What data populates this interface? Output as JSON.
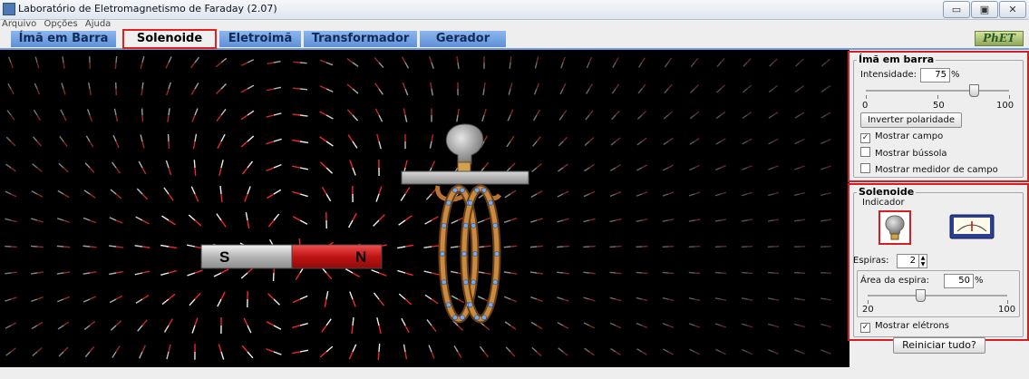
{
  "window": {
    "title": "Laboratório de Eletromagnetismo de Faraday (2.07)",
    "minimize_glyph": "▭",
    "maximize_glyph": "▣",
    "close_glyph": "✕"
  },
  "menu": [
    "Arquivo",
    "Opções",
    "Ajuda"
  ],
  "tabs": [
    {
      "label": "Ímã em Barra",
      "selected": false
    },
    {
      "label": "Solenoide",
      "selected": true
    },
    {
      "label": "Eletroimã",
      "selected": false
    },
    {
      "label": "Transformador",
      "selected": false
    },
    {
      "label": "Gerador",
      "selected": false
    }
  ],
  "logo_text": "PhET",
  "magnet": {
    "south": "S",
    "north": "N"
  },
  "bar_magnet_panel": {
    "title": "Ímã em barra",
    "strength_label": "Intensidade:",
    "strength_value": "75",
    "strength_unit": "%",
    "strength_fraction": 0.75,
    "scale": [
      "0",
      "50",
      "100"
    ],
    "flip_button": "Inverter polaridade",
    "checkboxes": [
      {
        "label": "Mostrar campo",
        "checked": true
      },
      {
        "label": "Mostrar bússola",
        "checked": false
      },
      {
        "label": "Mostrar medidor de campo",
        "checked": false
      }
    ]
  },
  "solenoid_panel": {
    "title": "Solenoide",
    "indicator_label": "Indicador",
    "indicators": [
      "lightbulb-icon",
      "voltmeter-icon"
    ],
    "selected_indicator": "lightbulb-icon",
    "loops_label": "Espiras:",
    "loops_value": "2",
    "area_label": "Área da espira:",
    "area_value": "50",
    "area_unit": "%",
    "area_fraction": 0.375,
    "area_scale": [
      "20",
      "100"
    ],
    "electrons_label": "Mostrar elétrons",
    "electrons_checked": true
  },
  "reset_button": "Reiniciar tudo?",
  "colors": {
    "accent_red": "#d31f23",
    "tab_blue": "#6f9fe0",
    "coil_orange": "#b87333",
    "electron_blue": "#7da7e0"
  }
}
